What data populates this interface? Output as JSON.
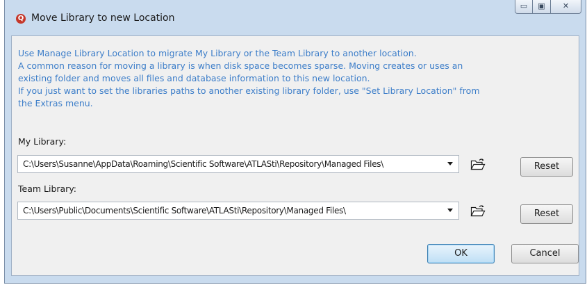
{
  "window": {
    "title": "Move Library to new Location",
    "controls": {
      "minimize_icon": "minimize-icon",
      "maximize_icon": "maximize-icon",
      "close_icon": "close-icon"
    }
  },
  "intro": {
    "lines": [
      "Use Manage Library Location to migrate My Library or the Team Library to another location.",
      "A common reason for moving a library is when disk space becomes sparse. Moving creates or uses an",
      "existing folder and moves all files and database information to this new location.",
      "If you just want to set the libraries paths to another existing library folder, use  \"Set Library Location\" from",
      "the Extras menu."
    ]
  },
  "my_library": {
    "label": "My Library:",
    "path": "C:\\Users\\Susanne\\AppData\\Roaming\\Scientific Software\\ATLASti\\Repository\\Managed Files\\",
    "reset_label": "Reset"
  },
  "team_library": {
    "label": "Team Library:",
    "path": "C:\\Users\\Public\\Documents\\Scientific Software\\ATLASti\\Repository\\Managed Files\\",
    "reset_label": "Reset"
  },
  "buttons": {
    "ok_label": "OK",
    "cancel_label": "Cancel"
  },
  "colors": {
    "intro_text": "#3d7ec9",
    "window_frame": "#c9dbee",
    "client_bg": "#f0f0f0"
  }
}
